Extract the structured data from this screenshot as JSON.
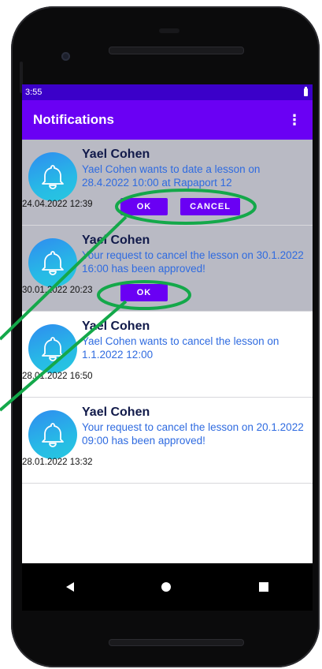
{
  "status_bar": {
    "time": "3:55"
  },
  "app_bar": {
    "title": "Notifications",
    "overflow_icon": "more-vert-icon"
  },
  "notifications": [
    {
      "sender": "Yael Cohen",
      "message": "Yael Cohen wants to date a lesson on 28.4.2022 10:00 at Rapaport 12",
      "date": "24.04.2022 12:39",
      "buttons": [
        "OK",
        "CANCEL"
      ]
    },
    {
      "sender": "Yael Cohen",
      "message": "Your request to cancel the lesson on 30.1.2022 16:00 has been approved!",
      "date": "30.01.2022 20:23",
      "buttons": [
        "OK"
      ]
    },
    {
      "sender": "Yael Cohen",
      "message": "Yael Cohen wants to cancel the lesson on 1.1.2022 12:00",
      "date": "28.01.2022 16:50",
      "buttons": []
    },
    {
      "sender": "Yael Cohen",
      "message": "Your request to cancel the lesson on 20.1.2022 09:00 has been approved!",
      "date": "28.01.2022 13:32",
      "buttons": []
    }
  ],
  "colors": {
    "status_bar": "#3b00c9",
    "app_bar": "#6a00f4",
    "button": "#6a00f4",
    "annotation": "#14a84a",
    "message_text": "#2f6be0"
  },
  "icons": {
    "notification": "bell-icon"
  }
}
